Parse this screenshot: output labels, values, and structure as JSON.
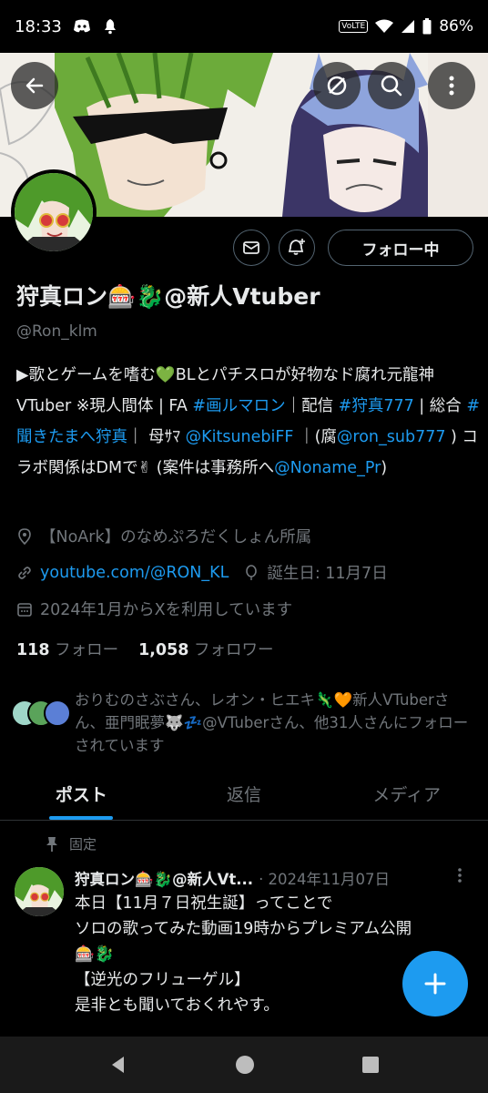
{
  "status_bar": {
    "time": "18:33",
    "volte": "VoLTE",
    "battery": "86%"
  },
  "profile": {
    "display_name": "狩真ロン🎰🐉@新人Vtuber",
    "handle": "@Ron_klm",
    "follow_button": "フォロー中",
    "bio": {
      "seg1": "▶歌とゲームを嗜む💚BLとパチスロが好物なド腐れ元龍神VTuber ※現人間体 | FA ",
      "tag_fa": "#画ルマロン",
      "seg2": "｜配信 ",
      "tag_stream": "#狩真777",
      "seg3": " | 総合 ",
      "tag_general": "#聞きたまへ狩真",
      "seg4": "｜ 母ｻﾏ ",
      "mention_mother": "@KitsunebiFF",
      "seg5": " ｜(腐",
      "mention_sub": "@ron_sub777",
      "seg6": " ) コラボ関係はDMで✌ (案件は事務所へ",
      "mention_office": "@Noname_Pr",
      "seg7": ")"
    },
    "location": "【NoArk】のなめぷろだくしょん所属",
    "website": "youtube.com/@RON_KL",
    "birthday": "誕生日: 11月7日",
    "joined": "2024年1月からXを利用しています",
    "following_count": "118",
    "following_label": "フォロー",
    "followers_count": "1,058",
    "followers_label": "フォロワー",
    "followed_by": "おりむのさぶさん、レオン・ヒエキ🦎🧡新人VTuberさん、亜門眠夢🐺💤@VTuberさん、他31人さんにフォローされています"
  },
  "tabs": [
    {
      "label": "ポスト"
    },
    {
      "label": "返信"
    },
    {
      "label": "メディア"
    }
  ],
  "pinned_post": {
    "pinned_label": "固定",
    "author": "狩真ロン🎰🐉@新人Vt...",
    "date": "· 2024年11月07日",
    "line1": "本日【11月７日祝生誕】ってことで",
    "line2": "ソロの歌ってみた動画19時からプレミアム公開",
    "line3": "🎰🐉",
    "line4": "【逆光のフリューゲル】",
    "line5": "是非とも聞いておくれやす。"
  },
  "colors": {
    "accent": "#1d9bf0",
    "background": "#000000",
    "secondary_text": "#71767b",
    "primary_text": "#e7e9ea"
  }
}
